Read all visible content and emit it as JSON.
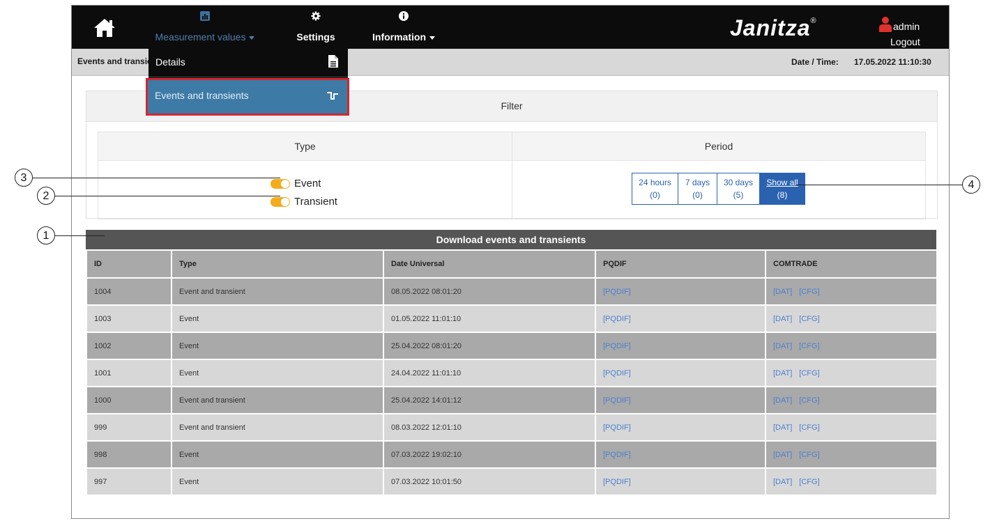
{
  "nav": {
    "measurement_values": "Measurement values",
    "settings": "Settings",
    "information": "Information",
    "brand": "Janitza",
    "brand_mark": "®",
    "user": "admin",
    "logout": "Logout"
  },
  "subbar": {
    "breadcrumb": "Events and transients",
    "datetime_label": "Date / Time:",
    "datetime_value": "17.05.2022 11:10:30"
  },
  "dropdown": {
    "details": "Details",
    "events": "Events and transients"
  },
  "filter": {
    "title": "Filter",
    "type_header": "Type",
    "period_header": "Period",
    "type_options": [
      {
        "label": "Event",
        "enabled": true
      },
      {
        "label": "Transient",
        "enabled": true
      }
    ],
    "period_buttons": [
      {
        "label": "24 hours",
        "count": "(0)",
        "active": false
      },
      {
        "label": "7 days",
        "count": "(0)",
        "active": false
      },
      {
        "label": "30 days",
        "count": "(5)",
        "active": false
      },
      {
        "label": "Show all",
        "count": "(8)",
        "active": true
      }
    ]
  },
  "table": {
    "title": "Download events and transients",
    "columns": [
      "ID",
      "Type",
      "Date Universal",
      "PQDIF",
      "COMTRADE"
    ],
    "rows": [
      {
        "id": "1004",
        "type": "Event and transient",
        "date": "08.05.2022 08:01:20",
        "pqdif": "[PQDIF]",
        "dat": "[DAT]",
        "cfg": "[CFG]"
      },
      {
        "id": "1003",
        "type": "Event",
        "date": "01.05.2022 11:01:10",
        "pqdif": "[PQDIF]",
        "dat": "[DAT]",
        "cfg": "[CFG]"
      },
      {
        "id": "1002",
        "type": "Event",
        "date": "25.04.2022 08:01:20",
        "pqdif": "[PQDIF]",
        "dat": "[DAT]",
        "cfg": "[CFG]"
      },
      {
        "id": "1001",
        "type": "Event",
        "date": "24.04.2022 11:01:10",
        "pqdif": "[PQDIF]",
        "dat": "[DAT]",
        "cfg": "[CFG]"
      },
      {
        "id": "1000",
        "type": "Event and transient",
        "date": "25.04.2022 14:01:12",
        "pqdif": "[PQDIF]",
        "dat": "[DAT]",
        "cfg": "[CFG]"
      },
      {
        "id": "999",
        "type": "Event and transient",
        "date": "08.03.2022 12:01:10",
        "pqdif": "[PQDIF]",
        "dat": "[DAT]",
        "cfg": "[CFG]"
      },
      {
        "id": "998",
        "type": "Event",
        "date": "07.03.2022 19:02:10",
        "pqdif": "[PQDIF]",
        "dat": "[DAT]",
        "cfg": "[CFG]"
      },
      {
        "id": "997",
        "type": "Event",
        "date": "07.03.2022 10:01:50",
        "pqdif": "[PQDIF]",
        "dat": "[DAT]",
        "cfg": "[CFG]"
      }
    ]
  },
  "callouts": [
    "1",
    "2",
    "3",
    "4"
  ],
  "icons": [
    "home-icon",
    "chart-icon",
    "gear-icon",
    "info-icon",
    "user-icon",
    "document-icon",
    "transient-wave-icon"
  ],
  "colors": {
    "navbar": "#0c0c0c",
    "toggle": "#f3ad1c",
    "accent_blue": "#2a62b0",
    "highlight_red": "#d22731",
    "menu_active": "#3e7aa6"
  }
}
